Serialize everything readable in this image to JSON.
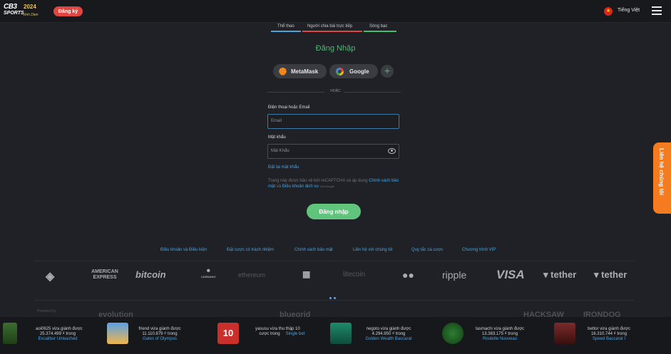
{
  "header": {
    "logo_top": "CB3",
    "logo_bottom": "SPORTS",
    "logo_badge": "2024",
    "logo_tag": "Vinh Dien",
    "register_label": "Đăng ký",
    "language_label": "Tiếng Việt",
    "flag_icon": "vietnam-flag-icon",
    "menu_icon": "hamburger-menu-icon"
  },
  "tabs": [
    {
      "label": "Thể thao",
      "color": "#4aa3e0"
    },
    {
      "label": "Người chia bài trực tiếp",
      "color": "#e2453f"
    },
    {
      "label": "Sòng bạc",
      "color": "#3fc16b"
    }
  ],
  "login": {
    "title": "Đăng Nhập",
    "metamask_label": "MetaMask",
    "google_label": "Google",
    "more_label": "+",
    "or_label": "HOẶC",
    "phone_email_label": "Điện thoại hoặc Email",
    "email_placeholder": "Email",
    "password_label": "Mật khẩu",
    "password_placeholder": "Mật Khẩu",
    "reset_label": "Đặt lại mật khẩu",
    "legal_text": "Trang này được bảo vệ bởi reCAPTCHA và áp dụng",
    "privacy_link": "Chính sách bảo mật",
    "and_text": "và",
    "terms_link": "Điều khoản dịch vụ",
    "google_text": "của Google",
    "submit_label": "Đăng nhập",
    "accent_color": "#3fc16b"
  },
  "contact_tab": "Liên hệ chúng tôi",
  "footer_links": [
    "Điều khoản và Điều kiện",
    "Đặt cược có trách nhiệm",
    "Chính sách bảo mật",
    "Liên hệ với chúng tôi",
    "Quy tắc cá cược",
    "Chương trình VIP"
  ],
  "payments": [
    "AMERICAN EXPRESS",
    "bitcoin",
    "CARDANO",
    "ethereum",
    "litecoin",
    "ripple",
    "VISA",
    "tether",
    "tether"
  ],
  "providers": [
    "Powered by",
    "evolution",
    "bluegrid",
    "HACKSAW",
    "IRONDOG"
  ],
  "winners": [
    {
      "line1": "aoi0625 vừa giành được",
      "line2": "25.374.499 ₫ trong",
      "game": "Excalibur Unleashed"
    },
    {
      "line1": "friend vừa giành được",
      "line2": "11.110.879 ₫ trong",
      "game": "Gates of Olympus"
    },
    {
      "line1": "yasusu vừa thu thập 10",
      "line2": "cược trong",
      "game": "Single bet"
    },
    {
      "line1": "negoto vừa giành được",
      "line2": "4.294.950 ₫ trong",
      "game": "Golden Wealth Baccarat"
    },
    {
      "line1": "tasmachi vừa giành được",
      "line2": "13.383.175 ₫ trong",
      "game": "Roulette Nouveau"
    },
    {
      "line1": "bettor vừa giành được",
      "line2": "16.310.744 ₫ trong",
      "game": "Speed Baccarat I"
    }
  ],
  "single_bet_badge": "10"
}
